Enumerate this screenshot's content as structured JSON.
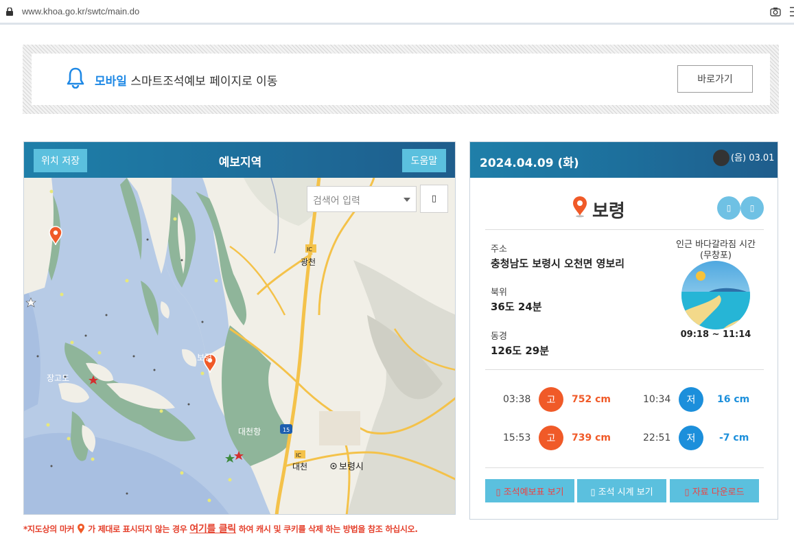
{
  "browser": {
    "url": "www.khoa.go.kr/swtc/main.do"
  },
  "banner": {
    "highlight": "모바일",
    "text": " 스마트조석예보 페이지로 이동",
    "button": "바로가기"
  },
  "map": {
    "save_button": "위치 저장",
    "title": "예보지역",
    "help_button": "도움말",
    "search_placeholder": "검색어 입력",
    "search_button": "▯",
    "labels": {
      "gwangcheon": "광천",
      "daecheon_port": "대천항",
      "daecheon": "대천",
      "boryeong_city": "보령시",
      "janggodo": "장고도",
      "boryeong": "보령",
      "ic1": "IC",
      "ic2": "IC",
      "route": "15"
    }
  },
  "note": {
    "prefix": "*지도상의 마커",
    "middle": "가 제대로 표시되지 않는 경우",
    "link": "여기를 클릭",
    "suffix": "하여 캐시 및 쿠키를 삭제 하는 방법을 참조 하십시오."
  },
  "info": {
    "date": "2024.04.09 (화)",
    "lunar": "(음) 03.01",
    "place": "보령",
    "icon_btn1": "▯",
    "icon_btn2": "▯",
    "address_label": "주소",
    "address": "충청남도 보령시 오천면 영보리",
    "lat_label": "북위",
    "lat": "36도 24분",
    "lon_label": "동경",
    "lon": "126도 29분",
    "sea_part_title": "인근 바다갈라짐 시간 (무창포)",
    "sea_part_time": "09:18 ~ 11:14",
    "tides": [
      {
        "time": "03:38",
        "type": "고",
        "value": "752 cm"
      },
      {
        "time": "10:34",
        "type": "저",
        "value": "16 cm"
      },
      {
        "time": "15:53",
        "type": "고",
        "value": "739 cm"
      },
      {
        "time": "22:51",
        "type": "저",
        "value": "-7 cm"
      }
    ],
    "actions": [
      "▯ 조석예보표 보기",
      "▯ 조석 시계 보기",
      "▯ 자료 다운로드"
    ]
  },
  "colors": {
    "header_blue": "#1d6f9c",
    "button_cyan": "#5bc0de",
    "high_tide": "#f05a28",
    "low_tide": "#1c8fdb",
    "accent_blue": "#1e88e5",
    "note_red": "#e5412d"
  }
}
